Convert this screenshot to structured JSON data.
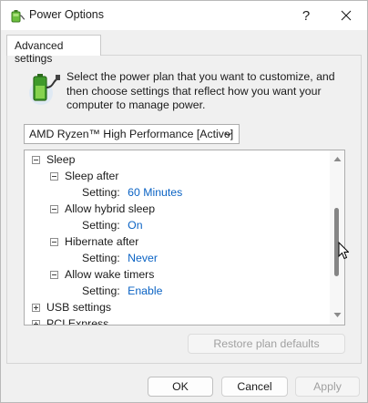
{
  "window": {
    "title": "Power Options",
    "help_glyph": "?",
    "app_icon": "power-options-icon"
  },
  "tabs": [
    {
      "label": "Advanced settings",
      "active": true
    }
  ],
  "description": {
    "icon": "battery-plug-icon",
    "text": "Select the power plan that you want to customize, and then choose settings that reflect how you want your computer to manage power."
  },
  "plan_select": {
    "value": "AMD Ryzen™ High Performance [Active]"
  },
  "tree": {
    "items": [
      {
        "kind": "group",
        "label": "Sleep",
        "expanded": true
      },
      {
        "kind": "subgroup",
        "label": "Sleep after",
        "expanded": true
      },
      {
        "kind": "setting",
        "label": "Setting:",
        "value": "60 Minutes"
      },
      {
        "kind": "subgroup",
        "label": "Allow hybrid sleep",
        "expanded": true
      },
      {
        "kind": "setting",
        "label": "Setting:",
        "value": "On"
      },
      {
        "kind": "subgroup",
        "label": "Hibernate after",
        "expanded": true
      },
      {
        "kind": "setting",
        "label": "Setting:",
        "value": "Never"
      },
      {
        "kind": "subgroup",
        "label": "Allow wake timers",
        "expanded": true
      },
      {
        "kind": "setting",
        "label": "Setting:",
        "value": "Enable"
      },
      {
        "kind": "group",
        "label": "USB settings",
        "expanded": false
      },
      {
        "kind": "group",
        "label": "PCI Express",
        "expanded": false
      }
    ]
  },
  "buttons": {
    "restore": "Restore plan defaults",
    "ok": "OK",
    "cancel": "Cancel",
    "apply": "Apply"
  },
  "colors": {
    "setting_value": "#0b63c4",
    "disabled_text": "#a0a0a0"
  }
}
